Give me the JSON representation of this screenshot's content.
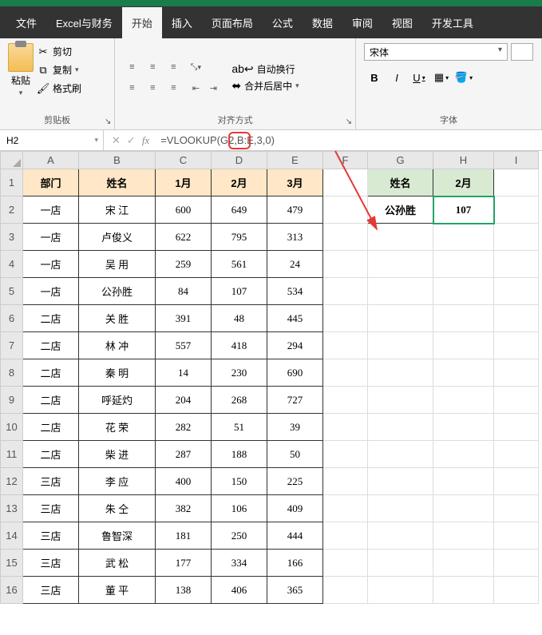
{
  "menu": {
    "file": "文件",
    "excel": "Excel与财务",
    "start": "开始",
    "insert": "插入",
    "layout": "页面布局",
    "formulas": "公式",
    "data": "数据",
    "review": "审阅",
    "view": "视图",
    "dev": "开发工具"
  },
  "ribbon": {
    "paste": "粘贴",
    "cut": "剪切",
    "copy": "复制",
    "brush": "格式刷",
    "clipboard": "剪贴板",
    "wrap": "自动换行",
    "merge": "合并后居中",
    "align": "对齐方式",
    "font_name": "宋体",
    "font_group": "字体",
    "bold": "B",
    "italic": "I",
    "underline": "U"
  },
  "namebox": "H2",
  "formula": "=VLOOKUP(G2,B:E,3,0)",
  "cols": [
    "A",
    "B",
    "C",
    "D",
    "E",
    "F",
    "G",
    "H",
    "I"
  ],
  "headers": {
    "dept": "部门",
    "name": "姓名",
    "m1": "1月",
    "m2": "2月",
    "m3": "3月",
    "lk_name": "姓名",
    "lk_m2": "2月"
  },
  "lookup": {
    "name": "公孙胜",
    "val": "107"
  },
  "rows": [
    {
      "dept": "一店",
      "name": "宋 江",
      "m1": "600",
      "m2": "649",
      "m3": "479"
    },
    {
      "dept": "一店",
      "name": "卢俊义",
      "m1": "622",
      "m2": "795",
      "m3": "313"
    },
    {
      "dept": "一店",
      "name": "吴 用",
      "m1": "259",
      "m2": "561",
      "m3": "24"
    },
    {
      "dept": "一店",
      "name": "公孙胜",
      "m1": "84",
      "m2": "107",
      "m3": "534"
    },
    {
      "dept": "二店",
      "name": "关 胜",
      "m1": "391",
      "m2": "48",
      "m3": "445"
    },
    {
      "dept": "二店",
      "name": "林 冲",
      "m1": "557",
      "m2": "418",
      "m3": "294"
    },
    {
      "dept": "二店",
      "name": "秦 明",
      "m1": "14",
      "m2": "230",
      "m3": "690"
    },
    {
      "dept": "二店",
      "name": "呼延灼",
      "m1": "204",
      "m2": "268",
      "m3": "727"
    },
    {
      "dept": "二店",
      "name": "花 荣",
      "m1": "282",
      "m2": "51",
      "m3": "39"
    },
    {
      "dept": "二店",
      "name": "柴 进",
      "m1": "287",
      "m2": "188",
      "m3": "50"
    },
    {
      "dept": "三店",
      "name": "李 应",
      "m1": "400",
      "m2": "150",
      "m3": "225"
    },
    {
      "dept": "三店",
      "name": "朱 仝",
      "m1": "382",
      "m2": "106",
      "m3": "409"
    },
    {
      "dept": "三店",
      "name": "鲁智深",
      "m1": "181",
      "m2": "250",
      "m3": "444"
    },
    {
      "dept": "三店",
      "name": "武 松",
      "m1": "177",
      "m2": "334",
      "m3": "166"
    },
    {
      "dept": "三店",
      "name": "董 平",
      "m1": "138",
      "m2": "406",
      "m3": "365"
    }
  ]
}
